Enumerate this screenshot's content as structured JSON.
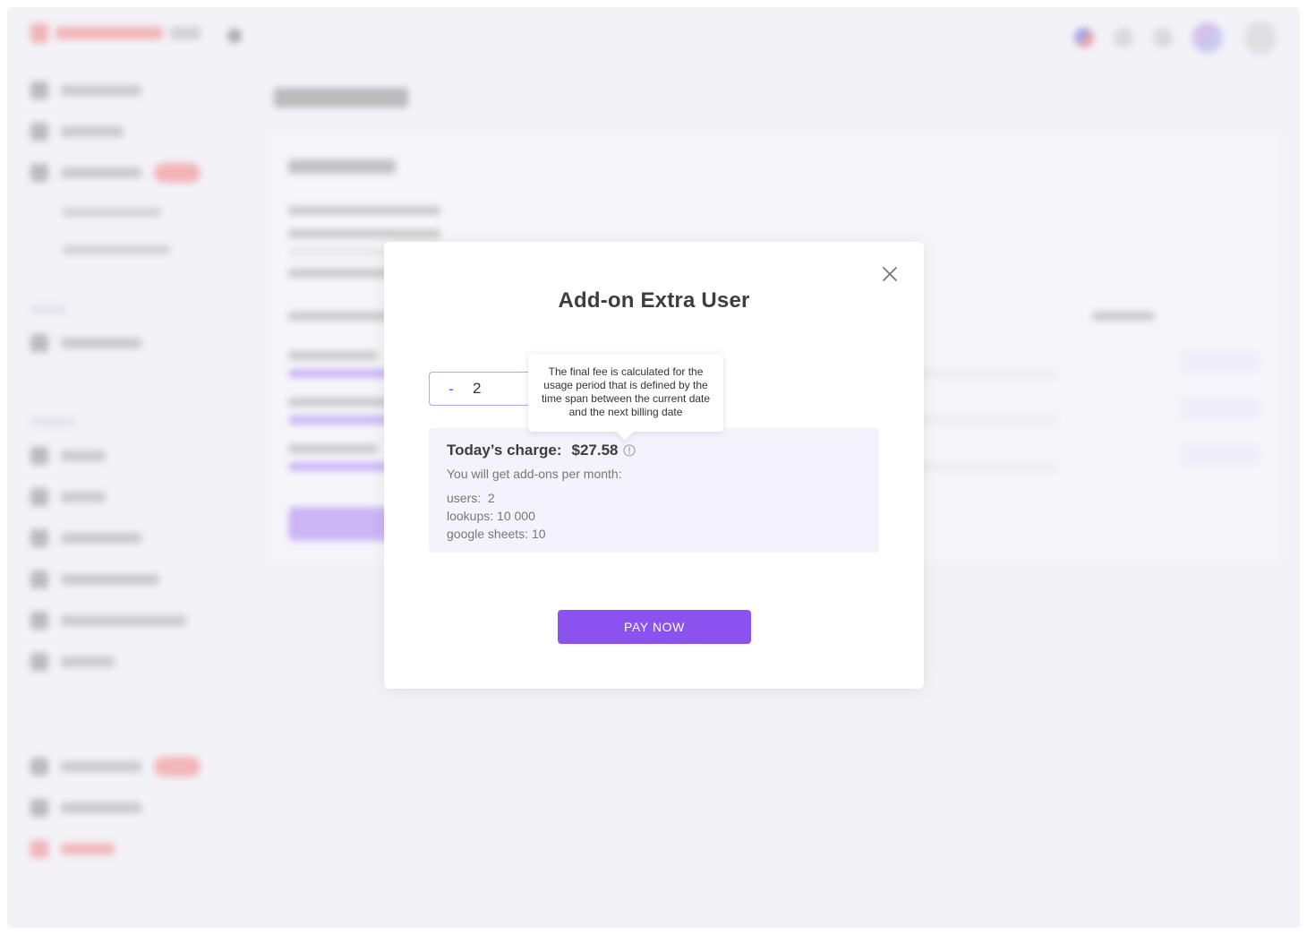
{
  "modal": {
    "title": "Add-on Extra User",
    "quantity": {
      "decrement_label": "-",
      "value": "2"
    },
    "tooltip": "The final fee is calculated for the usage period that is defined by the time span between the current date and the next billing date",
    "charge": {
      "label": "Today’s charge:",
      "amount": "$27.58",
      "description": "You will get add-ons per month:",
      "lines": [
        "users:  2",
        "lookups: 10 000",
        "google sheets: 10"
      ]
    },
    "pay_button": "PAY NOW"
  },
  "icons": {
    "close": "close-icon",
    "info": "info-icon"
  },
  "colors": {
    "accent": "#8c52f0",
    "stepper_border": "#b9a2ef",
    "charge_background": "#f4f2fc",
    "badge": "#f06a6a"
  }
}
